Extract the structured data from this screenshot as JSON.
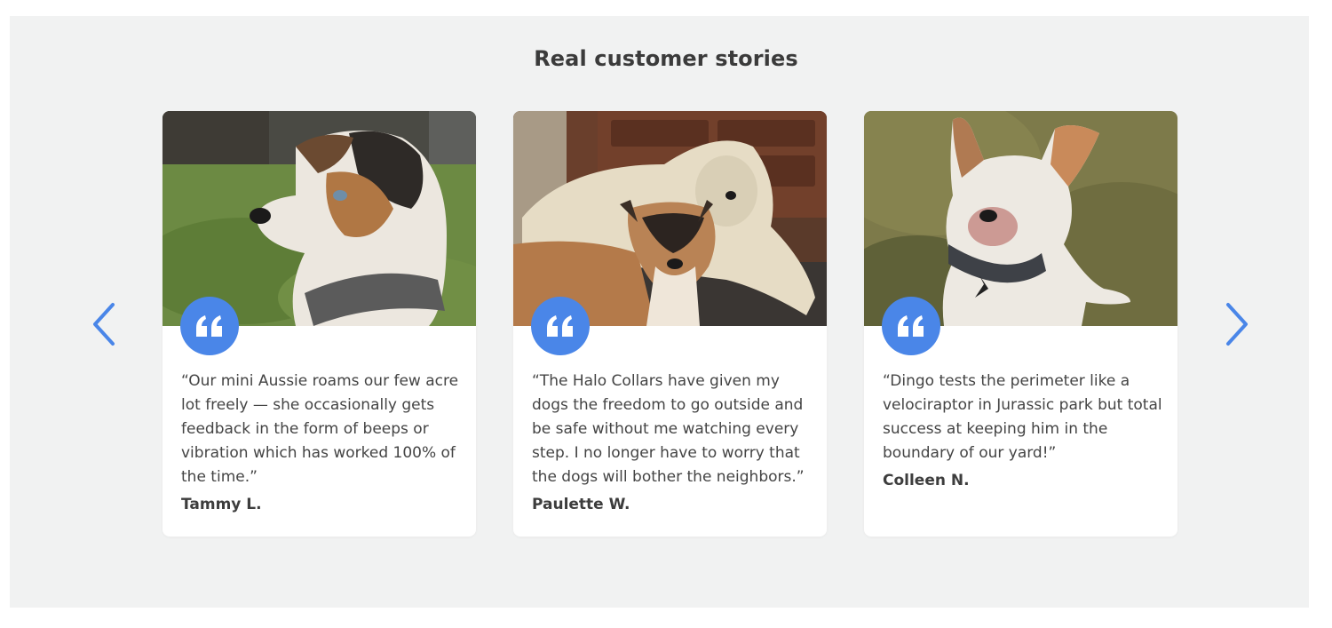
{
  "section": {
    "title": "Real customer stories"
  },
  "carousel": {
    "prev_icon": "chevron-left-icon",
    "next_icon": "chevron-right-icon",
    "accent_color": "#4a86e8",
    "testimonials": [
      {
        "photo": "mini Aussie dog wearing gray collar on lawn",
        "quote": "“Our mini Aussie roams our few acre lot freely — she occasionally gets feedback in the form of beeps or vibration which has worked 100% of the time.”",
        "author": "Tammy L."
      },
      {
        "photo": "two dogs (doodle and shepherd mix) lying indoors",
        "quote": "“The Halo Collars have given my dogs the freedom to go outside and be safe without me watching every step. I no longer have to worry that the dogs will bother the neighbors.”",
        "author": "Paulette W."
      },
      {
        "photo": "white heeler dog with one ear up on grass",
        "quote": "“Dingo tests the perimeter like a velociraptor in Jurassic park but total success at keeping him in the boundary of our yard!”",
        "author": "Colleen N."
      }
    ]
  }
}
